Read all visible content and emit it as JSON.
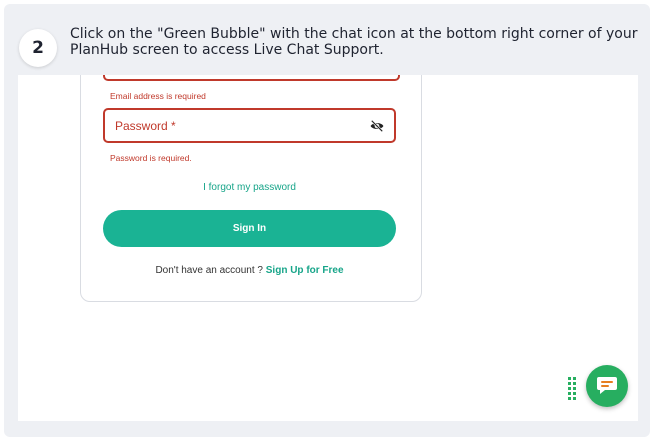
{
  "step": {
    "number": "2",
    "instruction": "Click on the \"Green Bubble\" with the chat icon at the bottom right corner of your PlanHub screen to access Live Chat Support."
  },
  "login": {
    "email_error": "Email address is required",
    "password_placeholder": "Password *",
    "password_error": "Password is required.",
    "forgot_password": "I forgot my password",
    "sign_in": "Sign In",
    "no_account": "Don't have an account ?",
    "sign_up": "Sign Up for Free"
  },
  "colors": {
    "accent": "#1ab394",
    "error": "#c0392b",
    "chat_bubble": "#27ae60",
    "chat_icon": "#e67e22"
  },
  "icons": {
    "password_toggle": "eye-off-icon",
    "chat": "chat-bubble-icon",
    "grip": "drag-handle-icon"
  }
}
